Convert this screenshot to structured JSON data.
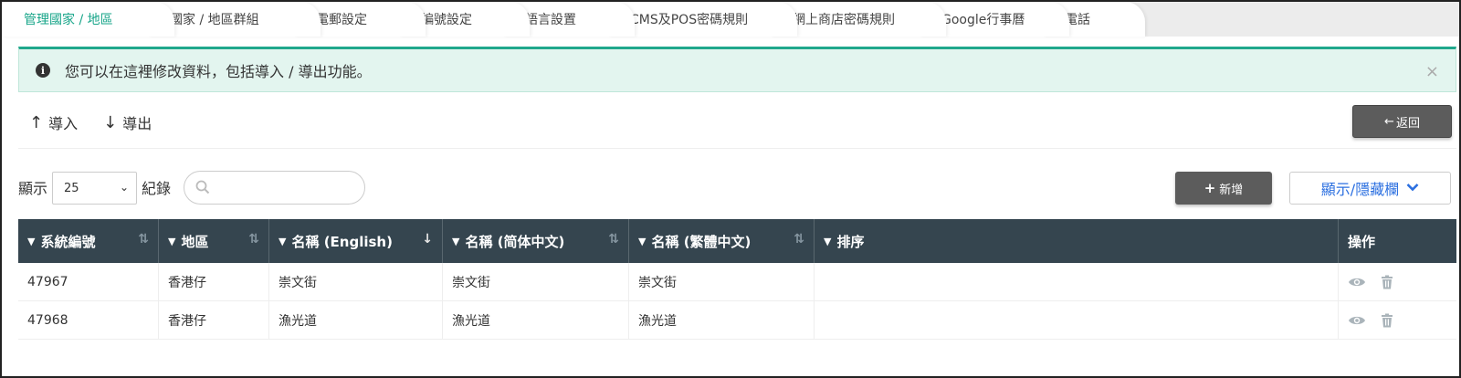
{
  "tabs": [
    {
      "label": "管理國家 / 地區",
      "active": true
    },
    {
      "label": "國家 / 地區群組"
    },
    {
      "label": "電郵設定"
    },
    {
      "label": "編號設定"
    },
    {
      "label": "語言設置"
    },
    {
      "label": "CMS及POS密碼規則"
    },
    {
      "label": "網上商店密碼規則"
    },
    {
      "label": "Google行事曆"
    },
    {
      "label": "電話"
    }
  ],
  "alert": {
    "icon": "info-icon",
    "text": "您可以在這裡修改資料，包括導入 / 導出功能。",
    "close": "×"
  },
  "toolbar": {
    "import_label": "導入",
    "export_label": "導出",
    "back_label": "返回"
  },
  "controls": {
    "show_label": "顯示",
    "page_size": "25",
    "records_label": "紀錄",
    "search_placeholder": "",
    "add_label": "新增",
    "toggle_columns_label": "顯示/隱藏欄"
  },
  "table": {
    "columns": [
      "系統編號",
      "地區",
      "名稱 (English)",
      "名稱 (简体中文)",
      "名稱 (繁體中文)",
      "排序",
      "操作"
    ],
    "rows": [
      {
        "id": "47967",
        "district": "香港仔",
        "name_en": "崇文街",
        "name_sc": "崇文街",
        "name_tc": "崇文街",
        "order": ""
      },
      {
        "id": "47968",
        "district": "香港仔",
        "name_en": "漁光道",
        "name_sc": "漁光道",
        "name_tc": "漁光道",
        "order": ""
      }
    ]
  },
  "colors": {
    "accent": "#17a589",
    "header_bg": "#35454f",
    "button_bg": "#5c5c5c",
    "link_blue": "#2b6fe0"
  }
}
